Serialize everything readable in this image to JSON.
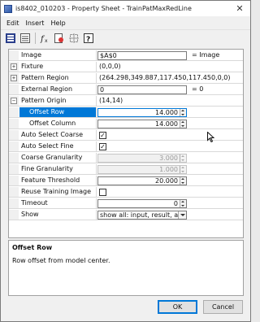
{
  "window": {
    "title": "is8402_010203 - Property Sheet - TrainPatMaxRedLine",
    "close_glyph": "✕"
  },
  "menu": [
    "Edit",
    "Insert",
    "Help"
  ],
  "toolbar": {
    "icons": [
      "categorized-view-icon",
      "alphabetical-view-icon",
      "function-icon",
      "link-icon",
      "pattern-icon",
      "help-icon"
    ]
  },
  "properties": [
    {
      "label": "Image",
      "kind": "text",
      "value": "$A$0",
      "suffix": "= Image",
      "expander": ""
    },
    {
      "label": "Fixture",
      "kind": "static",
      "value": "(0,0,0)",
      "expander": "+"
    },
    {
      "label": "Pattern Region",
      "kind": "static",
      "value": "(264.298,349.887,117.450,117.450,0,0)",
      "expander": "+"
    },
    {
      "label": "External Region",
      "kind": "text",
      "value": "0",
      "suffix": "= 0",
      "expander": ""
    },
    {
      "label": "Pattern Origin",
      "kind": "static",
      "value": "(14,14)",
      "expander": "−"
    },
    {
      "label": "Offset Row",
      "kind": "spin",
      "value": "14.000",
      "sub": true,
      "selected": true
    },
    {
      "label": "Offset Column",
      "kind": "spin",
      "value": "14.000",
      "sub": true
    },
    {
      "label": "Auto Select Coarse",
      "kind": "check",
      "checked": true
    },
    {
      "label": "Auto Select Fine",
      "kind": "check",
      "checked": true
    },
    {
      "label": "Coarse Granularity",
      "kind": "spin",
      "value": "3.000",
      "disabled": true
    },
    {
      "label": "Fine Granularity",
      "kind": "spin",
      "value": "1.000",
      "disabled": true
    },
    {
      "label": "Feature Threshold",
      "kind": "spin",
      "value": "20.000"
    },
    {
      "label": "Reuse Training Image",
      "kind": "check",
      "checked": false
    },
    {
      "label": "Timeout",
      "kind": "spin",
      "value": "0"
    },
    {
      "label": "Show",
      "kind": "select",
      "value": "show all: input, result, and tr"
    }
  ],
  "description": {
    "title": "Offset Row",
    "text": "Row offset from model center."
  },
  "buttons": {
    "ok": "OK",
    "cancel": "Cancel"
  },
  "colors": {
    "selection": "#0078d7"
  }
}
